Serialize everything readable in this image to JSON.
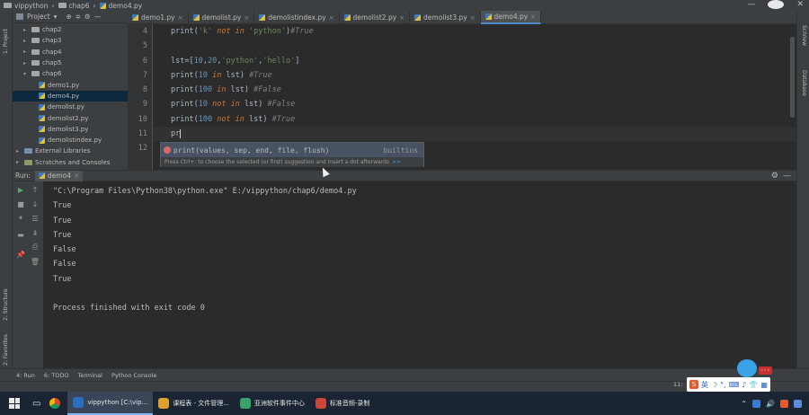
{
  "titlebar": {
    "project": "vippython",
    "folder": "chap6",
    "file": "demo4.py"
  },
  "project_panel": {
    "header": "Project",
    "items": [
      {
        "label": "chap2",
        "type": "folder",
        "indent": 1,
        "expanded": false
      },
      {
        "label": "chap3",
        "type": "folder",
        "indent": 1,
        "expanded": false
      },
      {
        "label": "chap4",
        "type": "folder",
        "indent": 1,
        "expanded": false
      },
      {
        "label": "chap5",
        "type": "folder",
        "indent": 1,
        "expanded": false
      },
      {
        "label": "chap6",
        "type": "folder",
        "indent": 1,
        "expanded": true
      },
      {
        "label": "demo1.py",
        "type": "file",
        "indent": 2
      },
      {
        "label": "demo4.py",
        "type": "file",
        "indent": 2,
        "selected": true
      },
      {
        "label": "demolist.py",
        "type": "file",
        "indent": 2
      },
      {
        "label": "demolist2.py",
        "type": "file",
        "indent": 2
      },
      {
        "label": "demolist3.py",
        "type": "file",
        "indent": 2
      },
      {
        "label": "demolistindex.py",
        "type": "file",
        "indent": 2
      },
      {
        "label": "External Libraries",
        "type": "lib",
        "indent": 0
      },
      {
        "label": "Scratches and Consoles",
        "type": "scratch",
        "indent": 0
      }
    ]
  },
  "tabs": [
    {
      "label": "demo1.py",
      "active": false
    },
    {
      "label": "demolist.py",
      "active": false
    },
    {
      "label": "demolistindex.py",
      "active": false
    },
    {
      "label": "demolist2.py",
      "active": false
    },
    {
      "label": "demolist3.py",
      "active": false
    },
    {
      "label": "demo4.py",
      "active": true
    }
  ],
  "editor": {
    "line_numbers": [
      "4",
      "5",
      "6",
      "7",
      "8",
      "9",
      "10",
      "11",
      "12"
    ],
    "typed_text": "pr"
  },
  "autocomplete": {
    "suggestion": "print(values, sep, end, file, flush)",
    "source": "builtins",
    "hint": "Press Ctrl+. to choose the selected (or first) suggestion and insert a dot afterwards",
    "hint_link": ">>"
  },
  "run_panel": {
    "label": "Run:",
    "tab": "demo4",
    "console_lines": [
      "\"C:\\Program Files\\Python38\\python.exe\" E:/vippython/chap6/demo4.py",
      "True",
      "True",
      "True",
      "False",
      "False",
      "True",
      "",
      "Process finished with exit code 0"
    ]
  },
  "left_strip": {
    "project": "1: Project",
    "structure": "2: Structure",
    "favorites": "2: Favorites"
  },
  "right_strip": {
    "scview": "SciView",
    "database": "Database"
  },
  "bottom_tools": [
    "4: Run",
    "6: TODO",
    "Terminal",
    "Python Console"
  ],
  "ime": {
    "lang": "英",
    "clock_partial": "11:"
  },
  "taskbar": {
    "items": [
      {
        "label": "vippython [C:\\vip...",
        "active": true
      },
      {
        "label": "课程表 - 文件管理...",
        "active": false
      },
      {
        "label": "亚洲软件事件中心",
        "active": false
      },
      {
        "label": "标准音频-录制",
        "active": false
      }
    ]
  },
  "colors": {
    "editor_bg": "#2b2b2b",
    "panel_bg": "#3c3f41",
    "keyword": "#cc7832",
    "string": "#6a8759",
    "number": "#6897bb",
    "comment": "#808080",
    "accent": "#4a88c7"
  }
}
